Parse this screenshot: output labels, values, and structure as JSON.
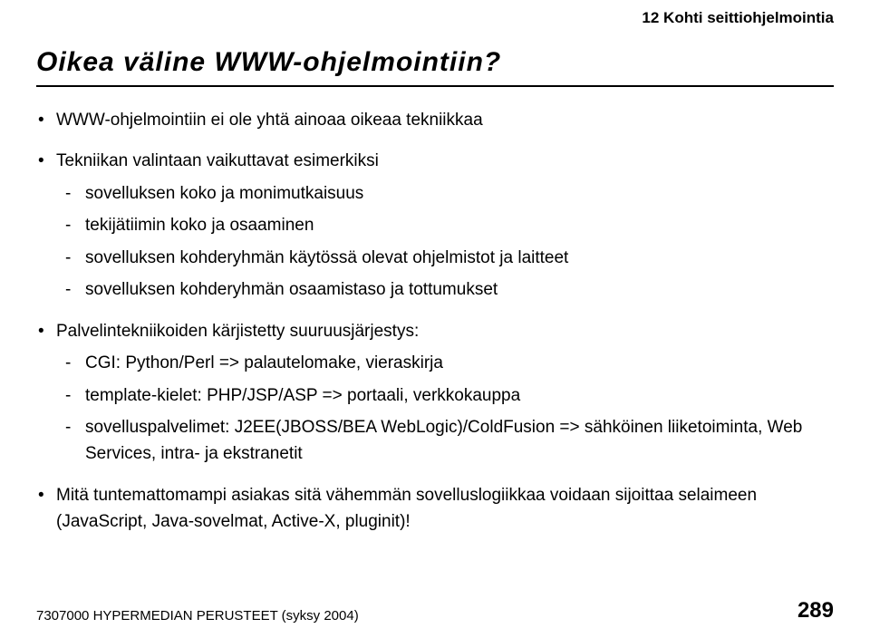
{
  "header_right": "12 Kohti seittiohjelmointia",
  "title": "Oikea väline WWW-ohjelmointiin?",
  "bullets": [
    {
      "text": "WWW-ohjelmointiin ei ole yhtä ainoaa oikeaa tekniikkaa",
      "subs": []
    },
    {
      "text": "Tekniikan valintaan vaikuttavat esimerkiksi",
      "subs": [
        "sovelluksen koko ja monimutkaisuus",
        "tekijätiimin koko ja osaaminen",
        "sovelluksen kohderyhmän käytössä olevat ohjelmistot ja laitteet",
        "sovelluksen kohderyhmän osaamistaso ja tottumukset"
      ]
    },
    {
      "text": "Palvelintekniikoiden kärjistetty suuruusjärjestys:",
      "subs": [
        "CGI: Python/Perl => palautelomake, vieraskirja",
        "template-kielet: PHP/JSP/ASP => portaali, verkkokauppa",
        "sovelluspalvelimet: J2EE(JBOSS/BEA WebLogic)/ColdFusion => sähköinen liiketoiminta, Web Services, intra- ja ekstranetit"
      ]
    },
    {
      "text": "Mitä tuntemattomampi asiakas sitä vähemmän sovelluslogiikkaa voidaan sijoittaa selaimeen (JavaScript, Java-sovelmat, Active-X, pluginit)!",
      "subs": []
    }
  ],
  "footer_left": "7307000 HYPERMEDIAN PERUSTEET (syksy 2004)",
  "footer_right": "289"
}
